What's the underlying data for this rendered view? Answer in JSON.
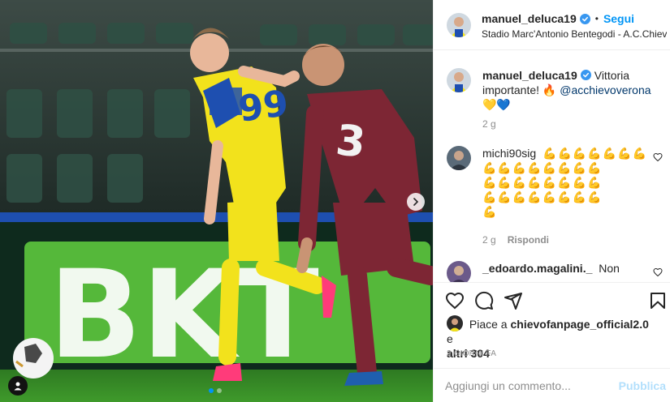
{
  "post": {
    "author": "manuel_deluca19",
    "follow_label": "Segui",
    "location": "Stadio Marc'Antonio Bentegodi - A.C.Chievo Verona",
    "caption_text": "Vittoria importante! 🔥",
    "caption_mention": "@acchievoverona",
    "caption_hearts": "💛💙",
    "caption_time": "2 g",
    "date": "2 GIORNI FA",
    "board_text": "BKT",
    "jersey_numbers": [
      "99",
      "3"
    ]
  },
  "comments": [
    {
      "user": "michi90sig",
      "emojis": [
        "💪💪💪💪💪💪💪",
        "💪💪💪💪💪💪💪💪",
        "💪💪💪💪💪💪💪💪",
        "💪💪💪💪💪💪💪💪",
        "💪"
      ],
      "time": "2 g",
      "reply_label": "Rispondi"
    },
    {
      "user": "_edoardo.magalini._",
      "text": "Non"
    }
  ],
  "likes": {
    "prefix": "Piace a",
    "user": "chievofanpage_official2.0",
    "joiner": "e",
    "others": "altri 304"
  },
  "add_comment": {
    "placeholder": "Aggiungi un commento...",
    "publish_label": "Pubblica"
  },
  "carousel": {
    "count": 2,
    "active_index": 0
  },
  "icons": [
    "verified-icon",
    "heart-icon",
    "comment-icon",
    "share-icon",
    "bookmark-icon",
    "chevron-right-icon",
    "user-tag-icon"
  ],
  "colors": {
    "link": "#0095f6",
    "mention": "#00376b",
    "muted": "#8e8e8e",
    "publish_disabled": "#b2dffc"
  }
}
